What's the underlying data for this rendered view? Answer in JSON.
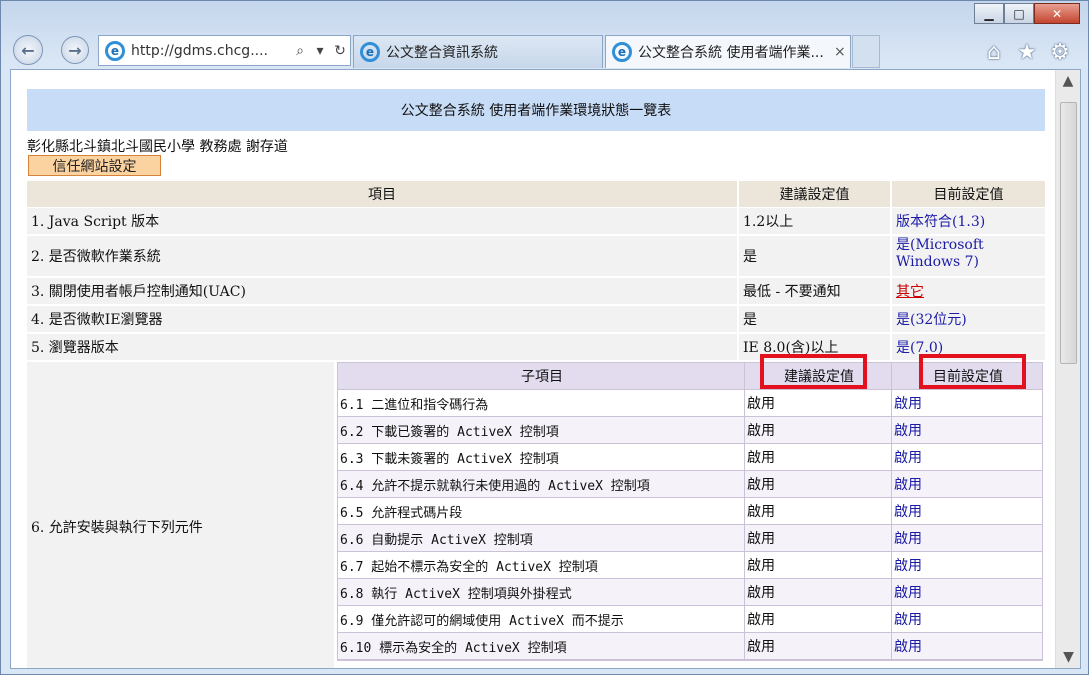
{
  "browser": {
    "address": "http://gdms.chcg....",
    "tabs": [
      {
        "label": "公文整合資訊系統"
      },
      {
        "label": "公文整合系統 使用者端作業...",
        "close": "×"
      }
    ],
    "icons": [
      "back-icon",
      "forward-icon",
      "ie-logo-icon",
      "search-icon",
      "dropdown-icon",
      "refresh-icon",
      "home-icon",
      "favorites-star-icon",
      "settings-gear-icon"
    ]
  },
  "page": {
    "title": "公文整合系統 使用者端作業環境狀態一覽表",
    "org": "彰化縣北斗鎮北斗國民小學 教務處 謝存道",
    "trust_button": "信任網站設定",
    "headers": {
      "item": "項目",
      "recommended": "建議設定值",
      "current": "目前設定值"
    },
    "rows": [
      {
        "item": "1. Java Script 版本",
        "recommended": "1.2以上",
        "current": "版本符合(1.3)"
      },
      {
        "item": "2. 是否微軟作業系統",
        "recommended": "是",
        "current": "是(Microsoft Windows 7)"
      },
      {
        "item": "3. 關閉使用者帳戶控制通知(UAC)",
        "recommended": "最低 - 不要通知",
        "current": "其它"
      },
      {
        "item": "4. 是否微軟IE瀏覽器",
        "recommended": "是",
        "current": "是(32位元)"
      },
      {
        "item": "5. 瀏覽器版本",
        "recommended": "IE 8.0(含)以上",
        "current": "是(7.0)"
      }
    ],
    "section6": {
      "label": "6. 允許安裝與執行下列元件",
      "headers": {
        "item": "子項目",
        "recommended": "建議設定值",
        "current": "目前設定值"
      },
      "rows": [
        {
          "item": "6.1 二進位和指令碼行為",
          "recommended": "啟用",
          "current": "啟用"
        },
        {
          "item": "6.2 下載已簽署的 ActiveX 控制項",
          "recommended": "啟用",
          "current": "啟用"
        },
        {
          "item": "6.3 下載未簽署的 ActiveX 控制項",
          "recommended": "啟用",
          "current": "啟用"
        },
        {
          "item": "6.4 允許不提示就執行未使用過的 ActiveX 控制項",
          "recommended": "啟用",
          "current": "啟用"
        },
        {
          "item": "6.5 允許程式碼片段",
          "recommended": "啟用",
          "current": "啟用"
        },
        {
          "item": "6.6 自動提示 ActiveX 控制項",
          "recommended": "啟用",
          "current": "啟用"
        },
        {
          "item": "6.7 起始不標示為安全的 ActiveX 控制項",
          "recommended": "啟用",
          "current": "啟用"
        },
        {
          "item": "6.8 執行 ActiveX 控制項與外掛程式",
          "recommended": "啟用",
          "current": "啟用"
        },
        {
          "item": "6.9 僅允許認可的網域使用 ActiveX 而不提示",
          "recommended": "啟用",
          "current": "啟用"
        },
        {
          "item": "6.10 標示為安全的 ActiveX 控制項",
          "recommended": "啟用",
          "current": "啟用"
        }
      ]
    }
  },
  "colors": {
    "banner": "#c7dcf7",
    "highlight": "#e3101e",
    "link": "#1b1ba6",
    "alert": "#c80000"
  }
}
